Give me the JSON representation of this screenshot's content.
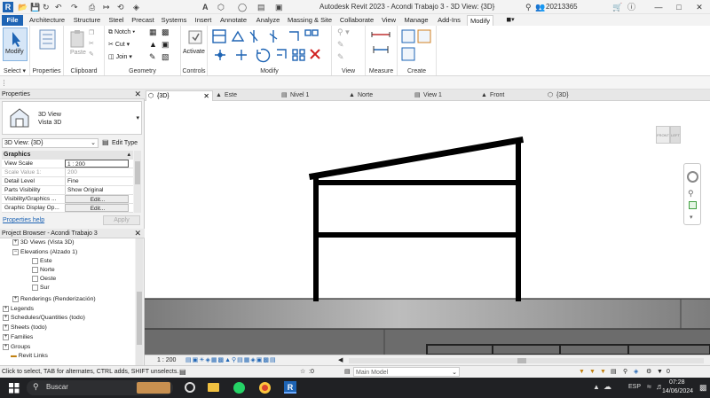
{
  "app": {
    "window_title": "Autodesk Revit 2023 - Acondi Trabajo 3 - 3D View: {3D}",
    "user": "20213365"
  },
  "ribbon_tabs": [
    "File",
    "Architecture",
    "Structure",
    "Steel",
    "Precast",
    "Systems",
    "Insert",
    "Annotate",
    "Analyze",
    "Massing & Site",
    "Collaborate",
    "View",
    "Manage",
    "Add-Ins",
    "Modify"
  ],
  "ribbon": {
    "modify_label": "Modify",
    "paste_label": "Paste",
    "notch_label": "Notch",
    "cut_label": "Cut",
    "join_label": "Join",
    "activate_label": "Activate",
    "panels": {
      "select": "Select",
      "properties": "Properties",
      "clipboard": "Clipboard",
      "geometry": "Geometry",
      "controls": "Controls",
      "modify": "Modify",
      "view": "View",
      "measure": "Measure",
      "create": "Create"
    }
  },
  "properties": {
    "header": "Properties",
    "type_name_line1": "3D View",
    "type_name_line2": "Vista 3D",
    "selector_value": "3D View: {3D}",
    "edit_type_label": "Edit Type",
    "group": "Graphics",
    "rows": [
      {
        "key": "View Scale",
        "value": "1 : 200"
      },
      {
        "key": "Scale Value    1:",
        "value": "200"
      },
      {
        "key": "Detail Level",
        "value": "Fine"
      },
      {
        "key": "Parts Visibility",
        "value": "Show Original"
      },
      {
        "key": "Visibility/Graphics ...",
        "value": "Edit..."
      },
      {
        "key": "Graphic Display Op...",
        "value": "Edit..."
      }
    ],
    "help_link": "Properties help",
    "apply_label": "Apply"
  },
  "project_browser": {
    "header": "Project Browser - Acondi Trabajo 3",
    "items": [
      {
        "label": "3D Views (Vista 3D)"
      },
      {
        "label": "Elevations (Alzado 1)"
      },
      {
        "label": "Este"
      },
      {
        "label": "Norte"
      },
      {
        "label": "Oeste"
      },
      {
        "label": "Sur"
      },
      {
        "label": "Renderings (Renderización)"
      },
      {
        "label": "Legends"
      },
      {
        "label": "Schedules/Quantities (todo)"
      },
      {
        "label": "Sheets (todo)"
      },
      {
        "label": "Families"
      },
      {
        "label": "Groups"
      },
      {
        "label": "Revit Links"
      }
    ]
  },
  "view_tabs": [
    "{3D}",
    "Este",
    "Nivel 1",
    "Norte",
    "View 1",
    "Front",
    "{3D}"
  ],
  "viewcube": {
    "left": "FRONT",
    "right": "LEFT"
  },
  "view_bar": {
    "scale": "1 : 200"
  },
  "status": {
    "message": "Click to select, TAB for alternates, CTRL adds, SHIFT unselects.",
    "zero": ":0",
    "model": "Main Model",
    "filter_count": "0"
  },
  "taskbar": {
    "search": "Buscar",
    "lang": "ESP",
    "time": "07:28",
    "date": "14/06/2024"
  },
  "colors": {
    "file_tab": "#1e64b4",
    "taskbar": "#202124",
    "structure": "#000000"
  }
}
